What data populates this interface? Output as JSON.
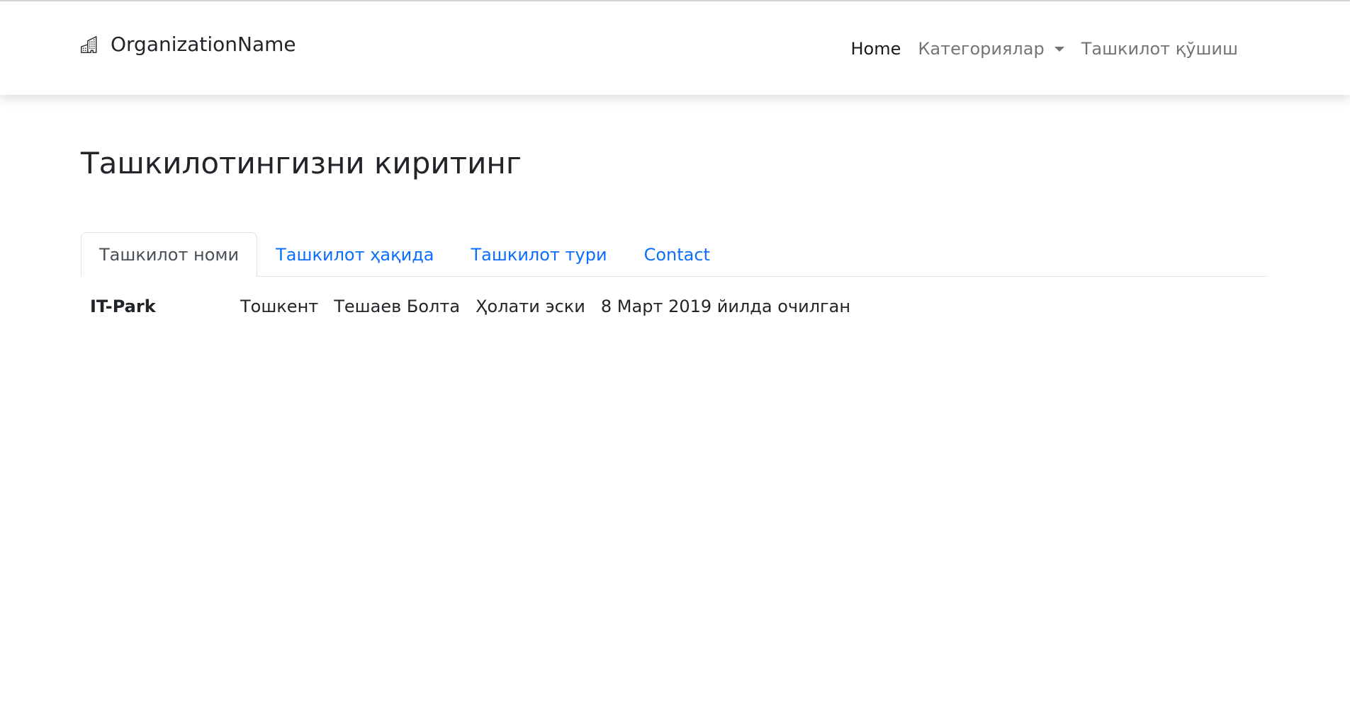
{
  "navbar": {
    "brand_icon": "building-icon",
    "brand_name": "OrganizationName",
    "links": {
      "home": "Home",
      "categories": "Категориялар",
      "add_org": "Ташкилот қўшиш"
    }
  },
  "main": {
    "title": "Ташкилотингизни киритинг",
    "tabs": [
      {
        "label": "Ташкилот номи",
        "active": true
      },
      {
        "label": "Ташкилот ҳақида",
        "active": false
      },
      {
        "label": "Ташкилот тури",
        "active": false
      },
      {
        "label": "Contact",
        "active": false
      }
    ],
    "organization": {
      "name": "IT-Park",
      "city": "Тошкент",
      "director": "Тешаев Болта",
      "status": "Ҳолати эски",
      "opened": "8 Март 2019 йилда очилган"
    }
  },
  "colors": {
    "link_blue": "#0d6efd",
    "text_dark": "#212529",
    "nav_muted": "#737373"
  }
}
